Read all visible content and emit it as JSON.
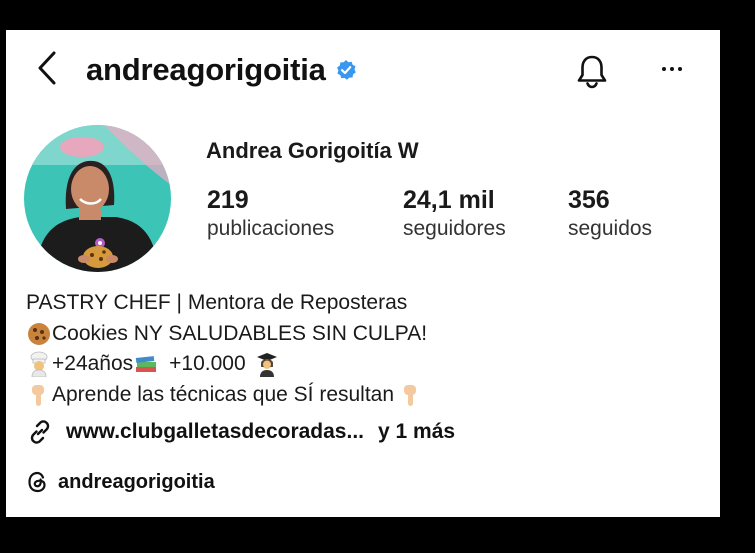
{
  "header": {
    "username": "andreagorigoitia",
    "back_icon": "chevron-left-icon",
    "verified_icon": "verified-badge-icon",
    "bell_icon": "bell-icon",
    "more_icon": "more-horizontal-icon",
    "accent_color": "#3897f0"
  },
  "profile": {
    "full_name": "Andrea Gorigoitía W",
    "stats": [
      {
        "value": "219",
        "label": "publicaciones"
      },
      {
        "value": "24,1 mil",
        "label": "seguidores"
      },
      {
        "value": "356",
        "label": "seguidos"
      }
    ]
  },
  "bio": {
    "line1": "PASTRY CHEF | Mentora de Reposteras",
    "line2": "Cookies NY SALUDABLES SIN CULPA!",
    "line3a": "+24años",
    "line3b": "+10.000",
    "line4": "Aprende las técnicas que SÍ resultan"
  },
  "link": {
    "text": "www.clubgalletasdecoradas...",
    "more": "y 1 más",
    "icon": "link-icon"
  },
  "threads": {
    "handle": "andreagorigoitia",
    "icon": "threads-icon"
  }
}
